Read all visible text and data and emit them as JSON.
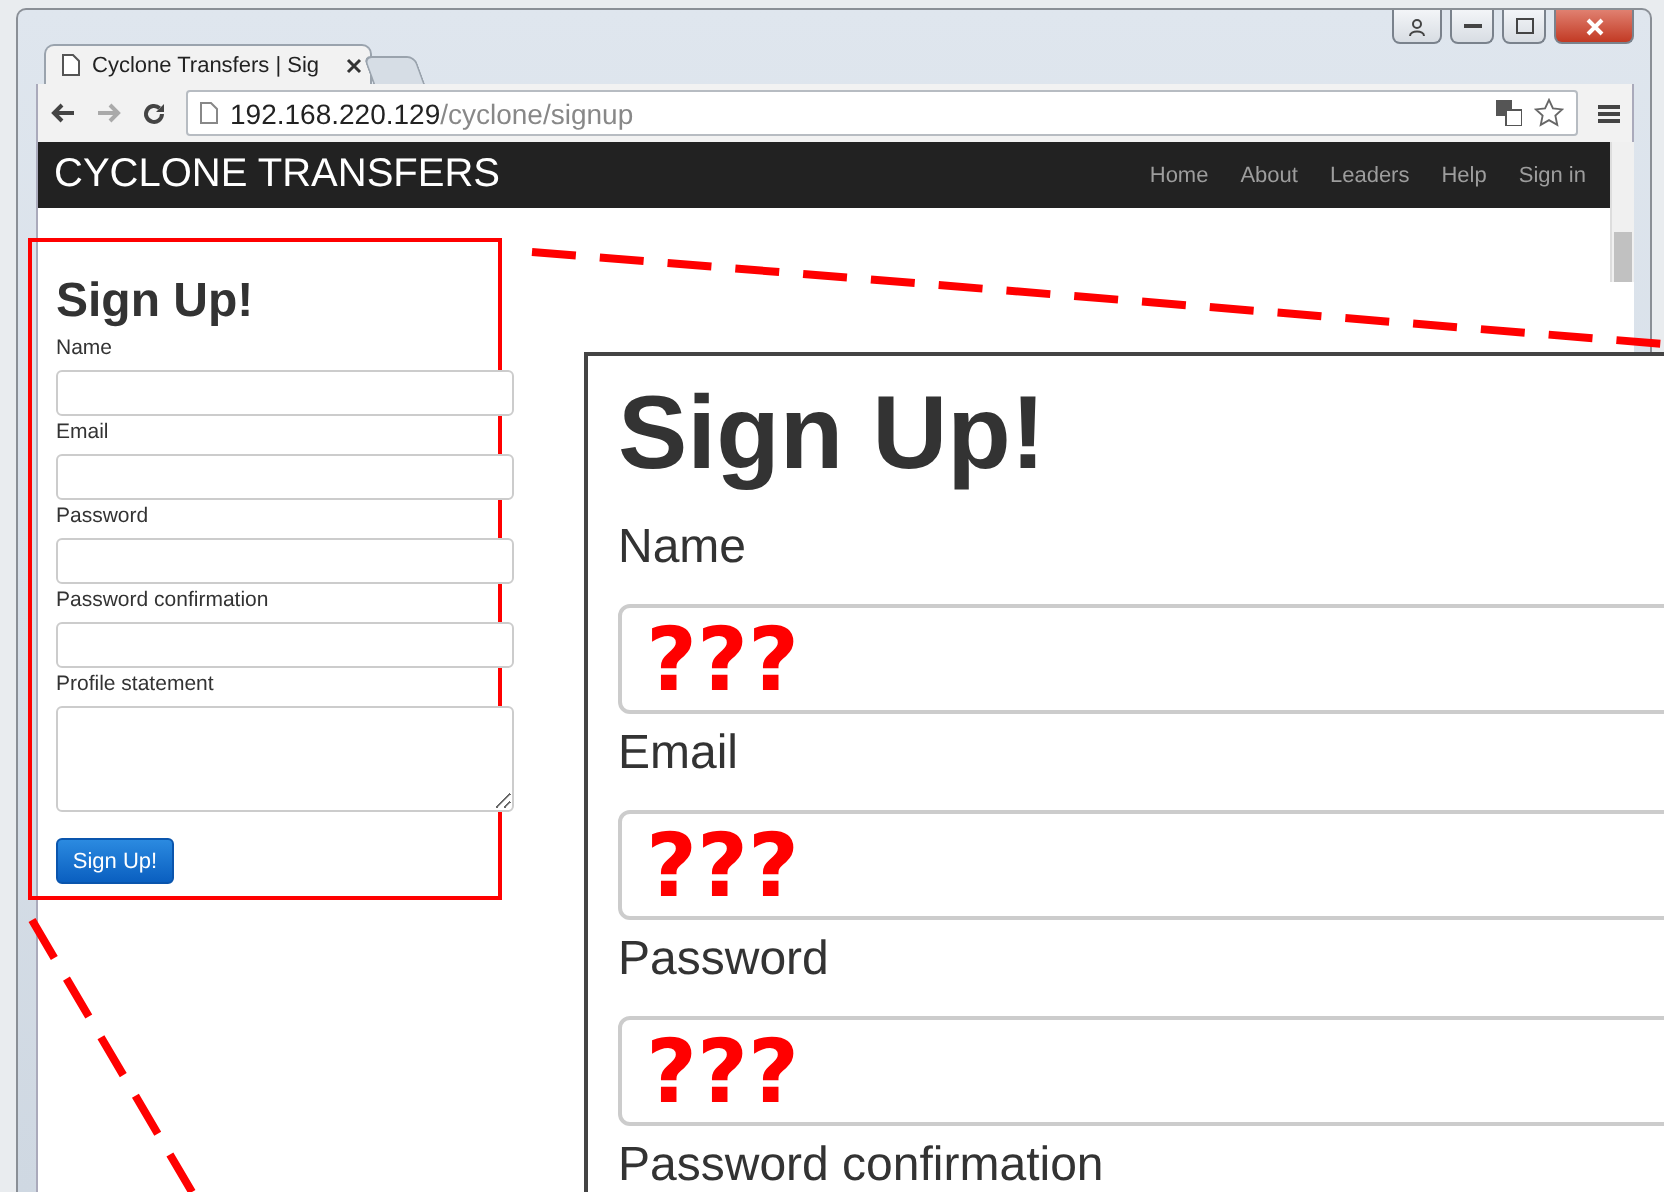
{
  "browser": {
    "tab_title": "Cyclone Transfers | Sig",
    "url_host": "192.168.220.129",
    "url_path": "/cyclone/signup"
  },
  "navbar": {
    "brand": "CYCLONE TRANSFERS",
    "links": [
      "Home",
      "About",
      "Leaders",
      "Help",
      "Sign in"
    ]
  },
  "form": {
    "title": "Sign Up!",
    "fields": [
      {
        "label": "Name",
        "kind": "input"
      },
      {
        "label": "Email",
        "kind": "input"
      },
      {
        "label": "Password",
        "kind": "input"
      },
      {
        "label": "Password confirmation",
        "kind": "input"
      },
      {
        "label": "Profile statement",
        "kind": "textarea"
      }
    ],
    "submit": "Sign Up!"
  },
  "callout": {
    "title": "Sign Up!",
    "fields": [
      {
        "label": "Name",
        "value": "???"
      },
      {
        "label": "Email",
        "value": "???"
      },
      {
        "label": "Password",
        "value": "???"
      },
      {
        "label": "Password confirmation"
      }
    ]
  }
}
